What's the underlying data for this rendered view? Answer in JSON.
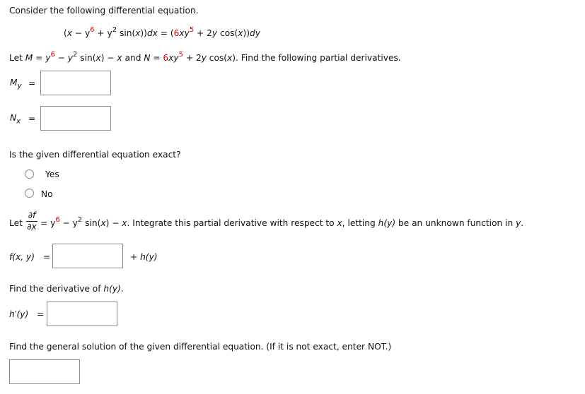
{
  "intro": "Consider the following differential equation.",
  "equation": {
    "p1": "(",
    "x": "x",
    "p2": " − y",
    "e1": "6",
    "p3": " + y",
    "e2": "2",
    "p4": " sin(",
    "x2": "x",
    "p5": "))",
    "dx": "dx",
    "p6": " = (",
    "six": "6",
    "xy": "xy",
    "e3": "5",
    "p7": " + 2",
    "y": "y",
    "p8": " cos(",
    "x3": "x",
    "p9": "))",
    "dy": "dy"
  },
  "let_line": {
    "t1": "Let ",
    "M": "M",
    "t2": " = ",
    "y1": "y",
    "e1": "6",
    "t3": " − ",
    "y2": "y",
    "e2": "2",
    "t4": " sin(",
    "x1": "x",
    "t5": ") − ",
    "x2": "x",
    "t6": " and ",
    "N": "N",
    "t7": " = ",
    "six": "6",
    "xy": "xy",
    "e3": "5",
    "t8": " + 2",
    "y3": "y",
    "t9": " cos(",
    "x3": "x",
    "t10": "). Find the following partial derivatives."
  },
  "My": {
    "M": "M",
    "sub": "y",
    "eq": "=",
    "value": ""
  },
  "Nx": {
    "N": "N",
    "sub": "x",
    "eq": "=",
    "value": ""
  },
  "exact_question": "Is the given differential equation exact?",
  "exact_options": [
    {
      "label": "Yes",
      "selected": false
    },
    {
      "label": "No",
      "selected": false
    }
  ],
  "integrate_line": {
    "let": "Let",
    "num": "∂f",
    "den": "∂x",
    "t1": "= y",
    "e1": "6",
    "t2": " − y",
    "e2": "2",
    "t3": " sin(",
    "x1": "x",
    "t4": ") − ",
    "x2": "x",
    "t5": ". Integrate this partial derivative with respect to ",
    "x3": "x",
    "t6": ", letting ",
    "h": "h(y)",
    "t7": " be an unknown function in ",
    "y": "y",
    "t8": "."
  },
  "fxy": {
    "label": "f(x, y)",
    "eq": "=",
    "value": "",
    "suffix": "+ h(y)"
  },
  "derivative_question": "Find the derivative of ",
  "derivative_h": "h(y)",
  "derivative_end": ".",
  "hprime": {
    "label": "h′(y)",
    "eq": "=",
    "value": ""
  },
  "general_question": "Find the general solution of the given differential equation. (If it is not exact, enter NOT.)",
  "general": {
    "value": ""
  }
}
